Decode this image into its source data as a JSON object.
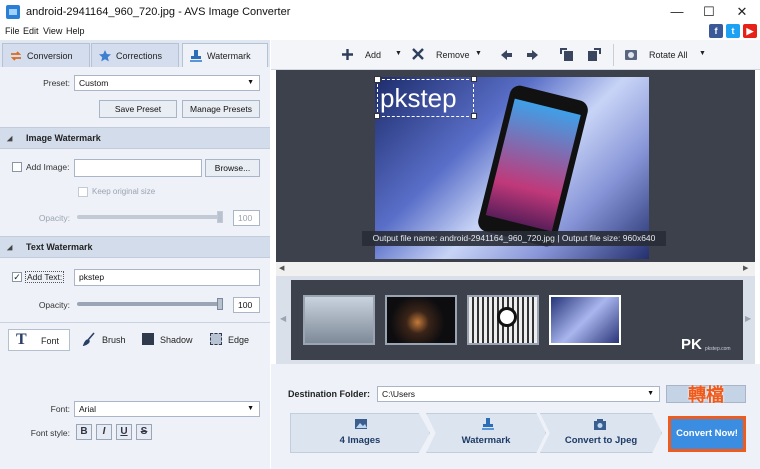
{
  "window": {
    "title": "android-2941164_960_720.jpg - AVS Image Converter",
    "minimize": "—",
    "maximize": "☐",
    "close": "✕"
  },
  "menu": [
    "File",
    "Edit",
    "View",
    "Help"
  ],
  "social": {
    "facebook": "f",
    "twitter": "t",
    "youtube": "▶"
  },
  "tabs": {
    "conversion": "Conversion",
    "corrections": "Corrections",
    "watermark": "Watermark"
  },
  "preset": {
    "label": "Preset:",
    "value": "Custom",
    "save": "Save Preset",
    "manage": "Manage Presets"
  },
  "image_watermark": {
    "title": "Image Watermark",
    "add_image_label": "Add Image:",
    "browse": "Browse...",
    "keep_size": "Keep original size",
    "opacity_label": "Opacity:",
    "opacity_value": "100",
    "opacity_level": 1.0
  },
  "text_watermark": {
    "title": "Text Watermark",
    "add_text_label": "Add Text:",
    "text_value": "pkstep",
    "opacity_label": "Opacity:",
    "opacity_value": "100",
    "opacity_level": 1.0
  },
  "text_tools": {
    "font": "Font",
    "brush": "Brush",
    "shadow": "Shadow",
    "edge": "Edge"
  },
  "font": {
    "label": "Font:",
    "value": "Arial",
    "style_label": "Font style:",
    "bold": "B",
    "italic": "I",
    "underline": "U",
    "strike": "S"
  },
  "toolbar": {
    "add": "Add",
    "remove": "Remove",
    "rotate_all": "Rotate All"
  },
  "preview": {
    "watermark_text": "pkstep",
    "info": "Output file name: android-2941164_960_720.jpg | Output file size: 960x640"
  },
  "logo": {
    "mark": "PK",
    "sub": "pkstep.com"
  },
  "destination": {
    "label": "Destination Folder:",
    "value": "C:\\Users"
  },
  "steps": {
    "images": "4 Images",
    "watermark": "Watermark",
    "convert_to": "Convert to Jpeg"
  },
  "convert_button": "Convert Now!",
  "stamp": "轉檔",
  "colors": {
    "accent": "#3a8de0",
    "highlight": "#f05a1a",
    "panel": "#dfe7f2"
  }
}
